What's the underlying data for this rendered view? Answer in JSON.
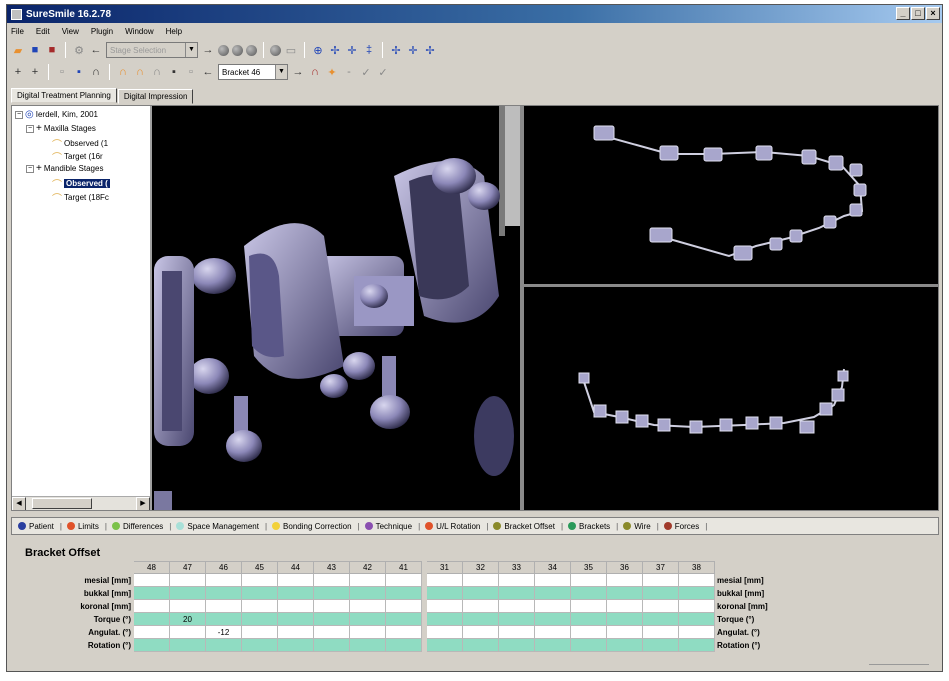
{
  "window": {
    "title": "SureSmile 16.2.78",
    "controls": [
      "_",
      "□",
      "×"
    ]
  },
  "menu": [
    "File",
    "Edit",
    "View",
    "Plugin",
    "Window",
    "Help"
  ],
  "toolbar1": {
    "disabled_combo": "Stage Selection",
    "icons": [
      "open-icon",
      "save-icon",
      "export-icon",
      "settings-icon",
      "back-arrow-icon",
      "forward-arrow-icon",
      "tooth-view-icon",
      "axis-icon"
    ]
  },
  "toolbar2": {
    "bracket_combo": "Bracket 46"
  },
  "tabs": [
    {
      "label": "Digital Treatment Planning",
      "active": true
    },
    {
      "label": "Digital Impression",
      "active": false
    }
  ],
  "tree": {
    "root": "Ierdell, Kim, 2001",
    "nodes": [
      {
        "label": "Maxilla Stages",
        "level": 1
      },
      {
        "label": "Observed (1",
        "level": 2
      },
      {
        "label": "Target (16r",
        "level": 2
      },
      {
        "label": "Mandible Stages",
        "level": 1
      },
      {
        "label": "Observed (",
        "level": 2,
        "selected": true
      },
      {
        "label": "Target (18Fc",
        "level": 2
      }
    ]
  },
  "legend": [
    {
      "label": "Patient",
      "color": "#2a3fa0"
    },
    {
      "label": "Limits",
      "color": "#e0522a"
    },
    {
      "label": "Differences",
      "color": "#7cc24a"
    },
    {
      "label": "Space Management",
      "color": "#a8e0d8"
    },
    {
      "label": "Bonding Correction",
      "color": "#f2d13a"
    },
    {
      "label": "Technique",
      "color": "#8a4fb0"
    },
    {
      "label": "U/L Rotation",
      "color": "#e0522a"
    },
    {
      "label": "Bracket Offset",
      "color": "#8a8a2a"
    },
    {
      "label": "Brackets",
      "color": "#2a9a5a"
    },
    {
      "label": "Wire",
      "color": "#8a8a2a"
    },
    {
      "label": "Forces",
      "color": "#a03a2a"
    }
  ],
  "section_title": "Bracket Offset",
  "grid": {
    "teeth_left": [
      "48",
      "47",
      "46",
      "45",
      "44",
      "43",
      "42",
      "41"
    ],
    "teeth_right": [
      "31",
      "32",
      "33",
      "34",
      "35",
      "36",
      "37",
      "38"
    ],
    "rows": [
      {
        "label": "mesial [mm]",
        "right_label": "mesial [mm]",
        "style": "w",
        "values_left": [
          "",
          "",
          "",
          "",
          "",
          "",
          "",
          ""
        ],
        "values_right": [
          "",
          "",
          "",
          "",
          "",
          "",
          "",
          ""
        ]
      },
      {
        "label": "bukkal [mm]",
        "right_label": "bukkal [mm]",
        "style": "g",
        "values_left": [
          "",
          "",
          "",
          "",
          "",
          "",
          "",
          ""
        ],
        "values_right": [
          "",
          "",
          "",
          "",
          "",
          "",
          "",
          ""
        ]
      },
      {
        "label": "koronal [mm]",
        "right_label": "koronal [mm]",
        "style": "w",
        "values_left": [
          "",
          "",
          "",
          "",
          "",
          "",
          "",
          ""
        ],
        "values_right": [
          "",
          "",
          "",
          "",
          "",
          "",
          "",
          ""
        ]
      },
      {
        "label": "Torque (°)",
        "right_label": "Torque (°)",
        "style": "g",
        "values_left": [
          "",
          "20",
          "",
          "",
          "",
          "",
          "",
          ""
        ],
        "values_right": [
          "",
          "",
          "",
          "",
          "",
          "",
          "",
          ""
        ]
      },
      {
        "label": "Angulat. (°)",
        "right_label": "Angulat. (°)",
        "style": "w",
        "values_left": [
          "",
          "",
          "-12",
          "",
          "",
          "",
          "",
          ""
        ],
        "values_right": [
          "",
          "",
          "",
          "",
          "",
          "",
          "",
          ""
        ]
      },
      {
        "label": "Rotation (°)",
        "right_label": "Rotation (°)",
        "style": "g",
        "values_left": [
          "",
          "",
          "",
          "",
          "",
          "",
          "",
          ""
        ],
        "values_right": [
          "",
          "",
          "",
          "",
          "",
          "",
          "",
          ""
        ]
      }
    ]
  }
}
